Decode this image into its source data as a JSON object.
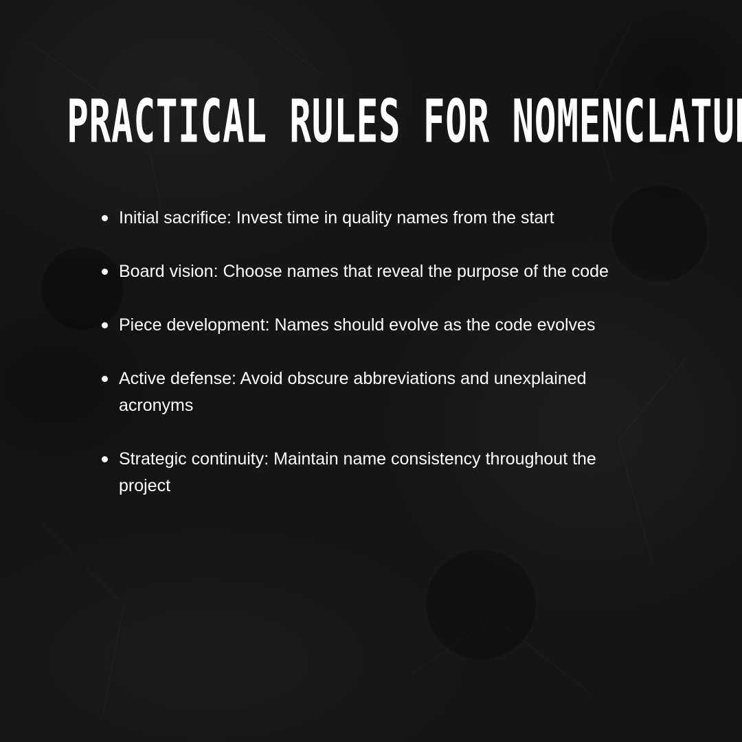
{
  "title": "Practical Rules for Nomenclature",
  "rules": [
    "Initial sacrifice: Invest time in quality names from the start",
    "Board vision: Choose names that reveal the purpose of the code",
    "Piece development: Names should evolve as the code evolves",
    "Active defense: Avoid obscure abbreviations and unexplained acronyms",
    "Strategic continuity: Maintain name consistency throughout the project"
  ],
  "colors": {
    "background": "#161616",
    "text": "#ffffff"
  }
}
